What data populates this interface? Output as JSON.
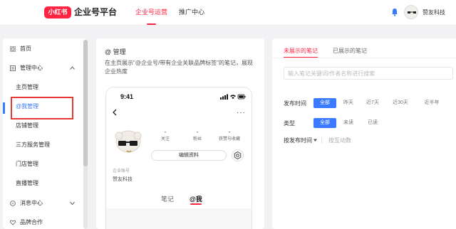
{
  "header": {
    "logo_badge": "小红书",
    "logo_text": "企业号平台",
    "nav": [
      {
        "label": "企业号运营",
        "active": true
      },
      {
        "label": "推广中心",
        "active": false
      }
    ],
    "user_name": "赞友科技",
    "accent_color": "#ff2442"
  },
  "sidebar": {
    "items": [
      {
        "label": "首页",
        "icon": "grid-icon"
      },
      {
        "label": "管理中心",
        "icon": "document-icon",
        "expanded": true
      },
      {
        "label": "主页管理"
      },
      {
        "label": "@我管理",
        "active": true
      },
      {
        "label": "店铺管理"
      },
      {
        "label": "三方服务管理"
      },
      {
        "label": "门店管理"
      },
      {
        "label": "直播管理"
      },
      {
        "label": "消息中心",
        "icon": "message-icon"
      },
      {
        "label": "品牌合作",
        "icon": "heart-icon"
      }
    ],
    "active_color": "#3a7afe"
  },
  "middle": {
    "title": "@ 管理",
    "description": "在主页展示\"@企业号/带有企业关联品牌标签\"的笔记，展现企业热度",
    "phone": {
      "time": "9:41",
      "stats": [
        {
          "value": "-",
          "label": "关注"
        },
        {
          "value": "-",
          "label": "粉丝"
        },
        {
          "value": "-",
          "label": "获赞与收藏"
        }
      ],
      "edit_button": "编辑资料",
      "account_label": "企业账号",
      "account_name": "赞友科技",
      "tabs": [
        {
          "label": "笔记",
          "active": false
        },
        {
          "label": "@我",
          "active": true
        }
      ]
    }
  },
  "right": {
    "tabs": [
      {
        "label": "未展示的笔记",
        "active": true
      },
      {
        "label": "已展示的笔记",
        "active": false
      }
    ],
    "search_placeholder": "输入笔记关键词/作者名称进行搜索",
    "publish_time": {
      "label": "发布时间",
      "options": [
        "全部",
        "昨天",
        "近7天",
        "近30天",
        "近半年"
      ],
      "selected": "全部"
    },
    "type": {
      "label": "类型",
      "options": [
        "全部",
        "未读",
        "已读"
      ],
      "selected": "全部"
    },
    "sort": {
      "active": "按发布时间",
      "other": "按互动数"
    }
  }
}
